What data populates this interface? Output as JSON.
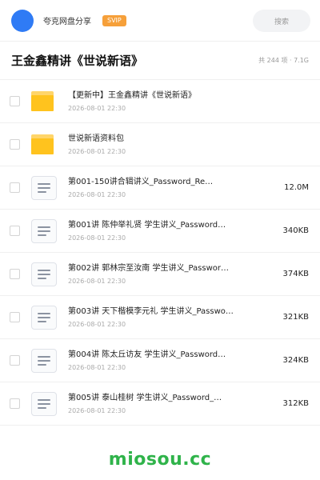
{
  "header": {
    "owner_name": "夸克网盘分享",
    "badge": "SVIP",
    "search_label": "搜索",
    "avatar_color": "#2f7bf5",
    "badge_color": "#f6a03a"
  },
  "title_bar": {
    "title": "王金鑫精讲《世说新语》",
    "summary": "共 244 项 · 7.1G"
  },
  "files": [
    {
      "icon": "folder-icon",
      "name": "【更新中】王金鑫精讲《世说新语》",
      "date": "2026-08-01 22:30",
      "size": ""
    },
    {
      "icon": "folder-icon",
      "name": "世说新语资料包",
      "date": "2026-08-01 22:30",
      "size": ""
    },
    {
      "icon": "document-icon",
      "name": "第001-150讲合辑讲义_Password_Re…",
      "date": "2026-08-01 22:30",
      "size": "12.0M"
    },
    {
      "icon": "document-icon",
      "name": "第001讲 陈仲举礼贤 学生讲义_Password…",
      "date": "2026-08-01 22:30",
      "size": "340KB"
    },
    {
      "icon": "document-icon",
      "name": "第002讲 郭林宗至汝南 学生讲义_Passwor…",
      "date": "2026-08-01 22:30",
      "size": "374KB"
    },
    {
      "icon": "document-icon",
      "name": "第003讲 天下楷模李元礼 学生讲义_Passwo…",
      "date": "2026-08-01 22:30",
      "size": "321KB"
    },
    {
      "icon": "document-icon",
      "name": "第004讲 陈太丘访友 学生讲义_Password…",
      "date": "2026-08-01 22:30",
      "size": "324KB"
    },
    {
      "icon": "document-icon",
      "name": "第005讲 泰山桂树 学生讲义_Password_…",
      "date": "2026-08-01 22:30",
      "size": "312KB"
    }
  ],
  "watermark": {
    "text": "miosou.cc",
    "color": "#2fb34a"
  }
}
